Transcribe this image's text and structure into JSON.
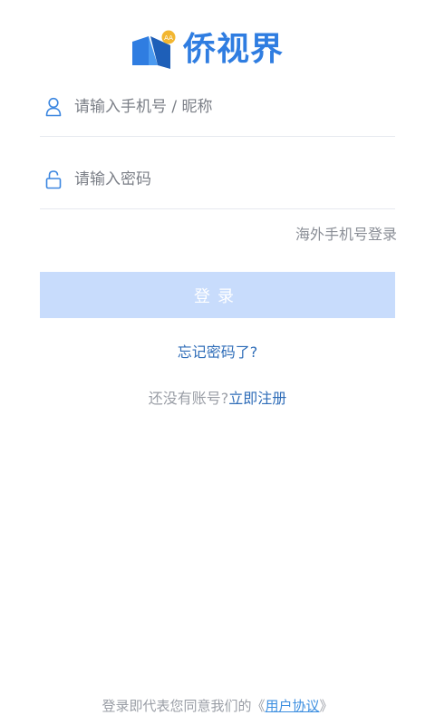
{
  "app": {
    "logo_text": "侨视界",
    "logo_badge": "AA",
    "accent_color": "#2f7de1"
  },
  "form": {
    "phone_placeholder": "请输入手机号 / 昵称",
    "password_placeholder": "请输入密码",
    "overseas_login": "海外手机号登录",
    "login_button": "登录",
    "forgot_password": "忘记密码了?",
    "no_account": "还没有账号?",
    "register_link": "立即注册"
  },
  "footer": {
    "agree_prefix": "登录即代表您同意我们的",
    "open_quote": "《",
    "agreement_link": "用户协议",
    "close_quote": "》"
  },
  "icons": {
    "user": "user-icon",
    "lock": "lock-icon"
  }
}
